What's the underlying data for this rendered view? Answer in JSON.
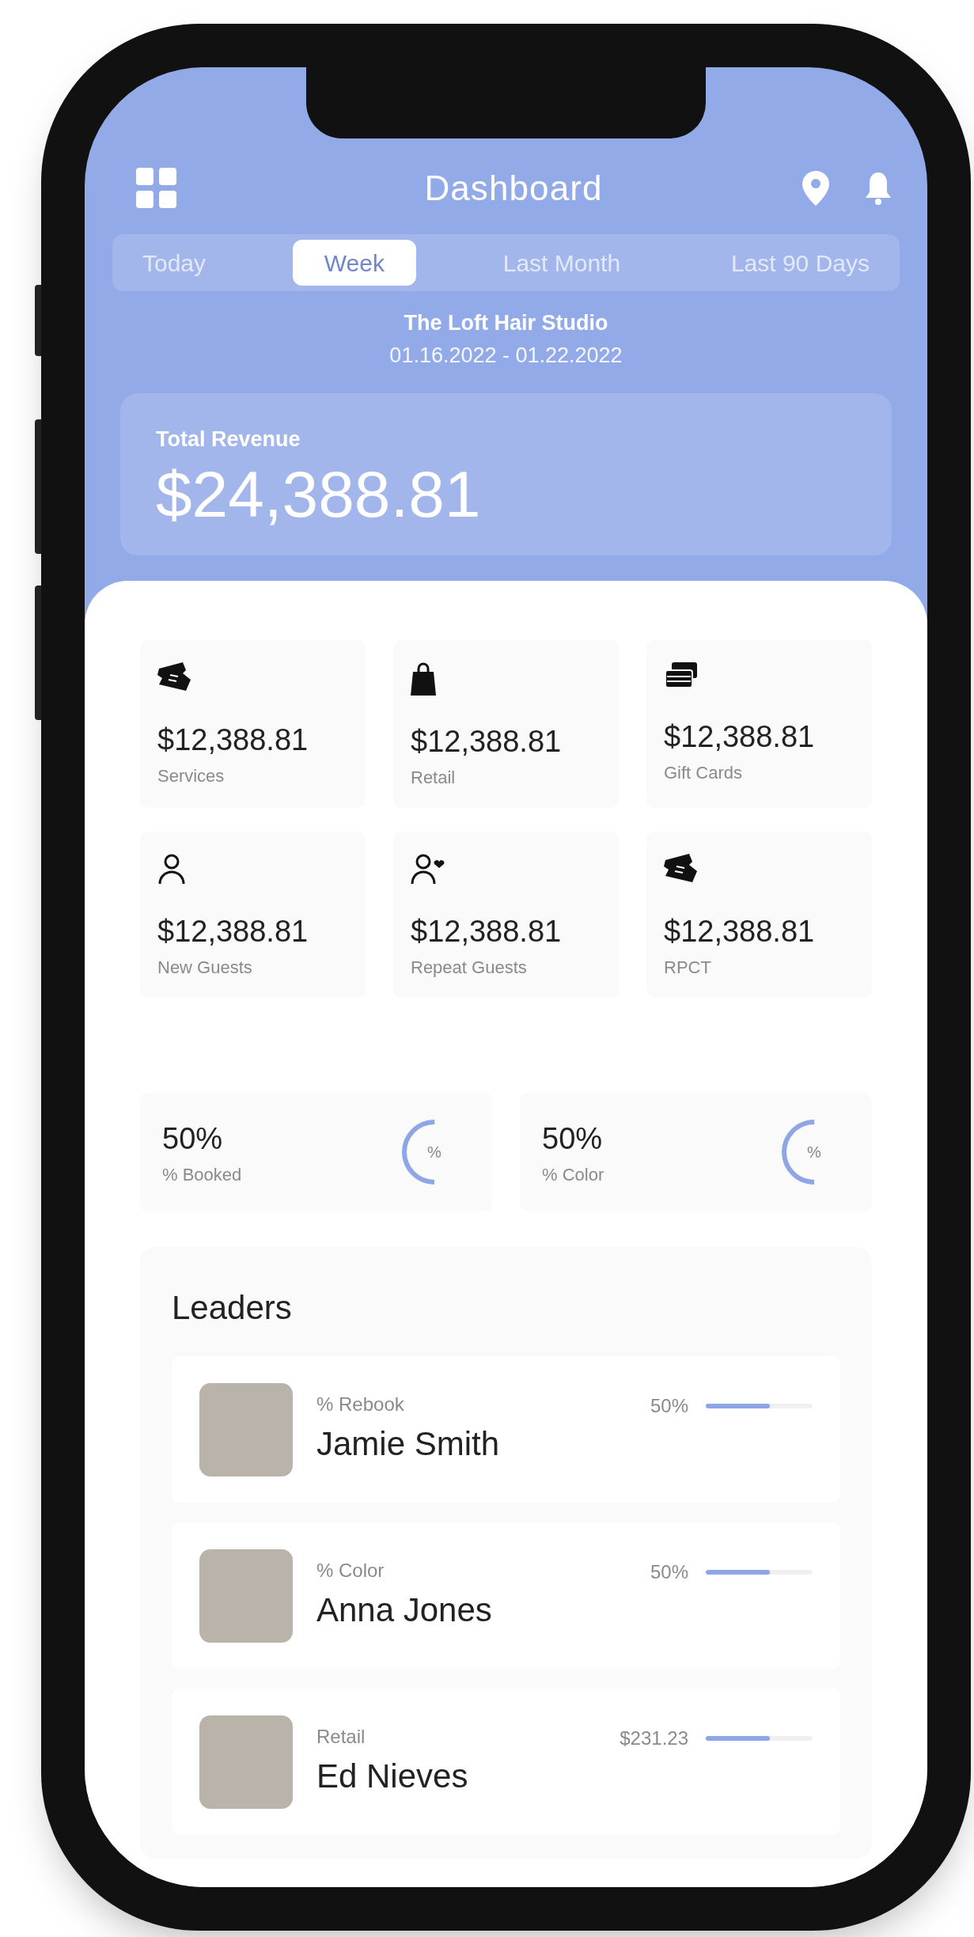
{
  "header": {
    "title": "Dashboard"
  },
  "tabs": [
    {
      "label": "Today",
      "selected": false
    },
    {
      "label": "Week",
      "selected": true
    },
    {
      "label": "Last Month",
      "selected": false
    },
    {
      "label": "Last 90 Days",
      "selected": false
    }
  ],
  "business": {
    "name": "The Loft Hair Studio",
    "date_range": "01.16.2022 - 01.22.2022"
  },
  "total_revenue": {
    "label": "Total Revenue",
    "value": "$24,388.81"
  },
  "stats": [
    {
      "kind": "ticket",
      "value": "$12,388.81",
      "label": "Services"
    },
    {
      "kind": "bag",
      "value": "$12,388.81",
      "label": "Retail"
    },
    {
      "kind": "cards",
      "value": "$12,388.81",
      "label": "Gift Cards"
    },
    {
      "kind": "person",
      "value": "$12,388.81",
      "label": "New Guests"
    },
    {
      "kind": "person-add",
      "value": "$12,388.81",
      "label": "Repeat Guests"
    },
    {
      "kind": "ticket",
      "value": "$12,388.81",
      "label": "RPCT"
    }
  ],
  "rates": [
    {
      "value": "50%",
      "label": "% Booked",
      "center": "%",
      "level": 0.5
    },
    {
      "value": "50%",
      "label": "% Color",
      "center": "%",
      "level": 0.5
    }
  ],
  "leaders": {
    "title": "Leaders",
    "rows": [
      {
        "metric": "% Rebook",
        "name": "Jamie Smith",
        "value": "50%",
        "level": 0.6
      },
      {
        "metric": "% Color",
        "name": "Anna Jones",
        "value": "50%",
        "level": 0.6
      },
      {
        "metric": "Retail",
        "name": "Ed Nieves",
        "value": "$231.23",
        "level": 0.6
      }
    ]
  }
}
